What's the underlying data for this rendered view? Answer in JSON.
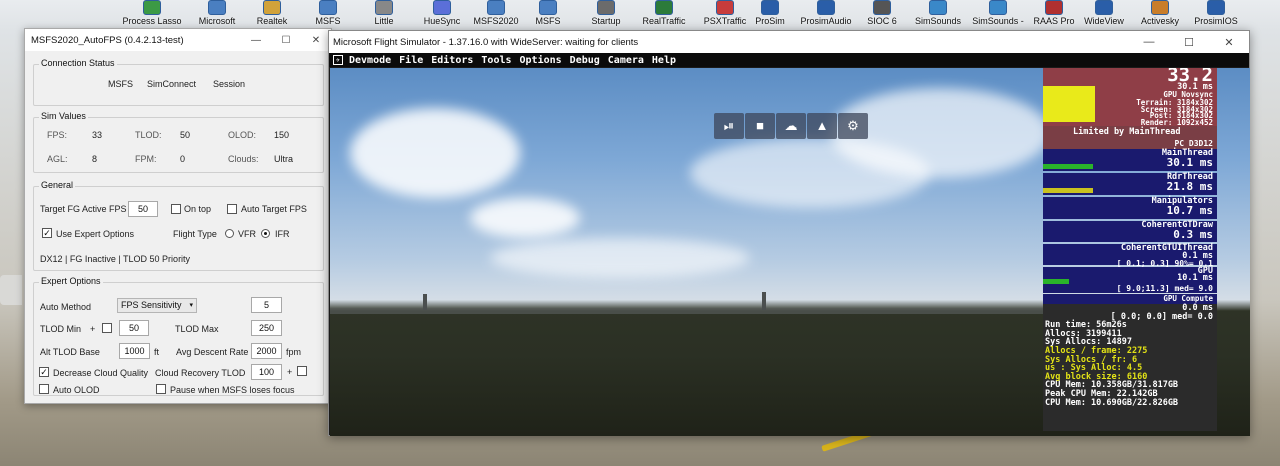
{
  "desktop": {
    "icons": [
      {
        "label": "Process Lasso",
        "x": "process"
      },
      {
        "label": "Microsoft",
        "x": "ms"
      },
      {
        "label": "Realtek",
        "x": "realtek"
      },
      {
        "label": "MSFS",
        "x": "msfs1"
      },
      {
        "label": "Little",
        "x": "little"
      },
      {
        "label": "HueSync",
        "x": "hue"
      },
      {
        "label": "MSFS2020",
        "x": "msfs2020"
      },
      {
        "label": "MSFS",
        "x": "msfs2"
      },
      {
        "label": "Startup",
        "x": "startup"
      },
      {
        "label": "RealTraffic",
        "x": "realtraffic"
      },
      {
        "label": "PSXTraffic",
        "x": "psx"
      },
      {
        "label": "ProSim",
        "x": "prosim"
      },
      {
        "label": "ProsimAudio",
        "x": "prosimaudio"
      },
      {
        "label": "SIOC 6",
        "x": "sioc"
      },
      {
        "label": "SimSounds",
        "x": "simsounds"
      },
      {
        "label": "SimSounds -",
        "x": "simsounds2"
      },
      {
        "label": "RAAS Pro",
        "x": "raas"
      },
      {
        "label": "WideView",
        "x": "wideview"
      },
      {
        "label": "Activesky",
        "x": "activesky"
      },
      {
        "label": "ProsimIOS",
        "x": "prosimios"
      }
    ]
  },
  "autofps": {
    "title": "MSFS2020_AutoFPS (0.4.2.13-test)",
    "min": "—",
    "max": "☐",
    "close": "✕",
    "connection": {
      "heading": "Connection Status",
      "items": [
        "MSFS",
        "SimConnect",
        "Session"
      ]
    },
    "sim_values": {
      "heading": "Sim Values",
      "fps_label": "FPS:",
      "fps": "33",
      "tlod_label": "TLOD:",
      "tlod": "50",
      "olod_label": "OLOD:",
      "olod": "150",
      "agl_label": "AGL:",
      "agl": "8",
      "fpm_label": "FPM:",
      "fpm": "0",
      "clouds_label": "Clouds:",
      "clouds": "Ultra"
    },
    "general": {
      "heading": "General",
      "target_label": "Target FG Active FPS",
      "target_value": "50",
      "on_top": "On top",
      "auto_target": "Auto Target FPS",
      "expert": "Use Expert Options",
      "flight_type": "Flight Type",
      "vfr": "VFR",
      "ifr": "IFR",
      "status": "DX12 | FG Inactive | TLOD 50 Priority"
    },
    "expert": {
      "heading": "Expert Options",
      "auto_method_label": "Auto Method",
      "auto_method_value": "FPS Sensitivity",
      "sensitivity": "5",
      "tlod_min_label": "TLOD Min",
      "plus": "+",
      "tlod_min": "50",
      "tlod_max_label": "TLOD Max",
      "tlod_max": "250",
      "alt_base_label": "Alt TLOD Base",
      "alt_base": "1000",
      "ft": "ft",
      "descent_label": "Avg Descent Rate",
      "descent": "2000",
      "fpm": "fpm",
      "decrease_cloud": "Decrease Cloud Quality",
      "cloud_recovery_label": "Cloud Recovery TLOD",
      "cloud_recovery": "100",
      "auto_olod": "Auto OLOD",
      "pause": "Pause when MSFS loses focus"
    }
  },
  "msfs": {
    "title": "Microsoft Flight Simulator - 1.37.16.0 with WideServer: waiting for clients",
    "min": "—",
    "max": "☐",
    "close": "✕",
    "menu": [
      "Devmode",
      "File",
      "Editors",
      "Tools",
      "Options",
      "Debug",
      "Camera",
      "Help"
    ],
    "toolbar_icons": [
      "play-pause-icon",
      "camera-icon",
      "weather-icon",
      "aircraft-icon",
      "settings-icon"
    ],
    "overlay": {
      "fps": "33.2",
      "lines_top": [
        "30.1 ms",
        "GPU Novsync",
        "Terrain: 3184x302",
        "Screen: 3184x302",
        "Post: 3184x302",
        "Render: 1092x452"
      ],
      "limited": "Limited by MainThread",
      "pc": "PC D3D12",
      "main_label": "MainThread",
      "main_ms": "30.1 ms",
      "rdr_label": "RdrThread",
      "rdr_ms": "21.8 ms",
      "manip_label": "Manipulators",
      "manip_ms": "10.7 ms",
      "coh_label": "CoherentGTDraw",
      "coh_ms": "0.3 ms",
      "coh2_label": "CoherentGTUIThread",
      "coh2_ms": "0.1 ms",
      "coh2_range": "[ 0.1; 0.3] 90%= 0.1",
      "gpu_label": "GPU",
      "gpu_ms": "10.1 ms",
      "gpu_range": "[ 9.0;11.3] med= 9.0",
      "gpuc_label": "GPU Compute",
      "gpuc_ms": "0.0 ms",
      "gpuc_range": "[ 0.0; 0.0] med= 0.0",
      "stats": [
        {
          "t": "Run time: 56m26s",
          "y": false
        },
        {
          "t": "Allocs: 3199411",
          "y": false
        },
        {
          "t": "  Sys Allocs: 14897",
          "y": false
        },
        {
          "t": "Allocs / frame: 2275",
          "y": true
        },
        {
          "t": "  Sys Allocs / fr: 6",
          "y": true
        },
        {
          "t": "  us : Sys Alloc: 4.5",
          "y": true
        },
        {
          "t": "Avg block size: 6160",
          "y": true
        },
        {
          "t": "CPU Mem: 10.358GB/31.817GB",
          "y": false
        },
        {
          "t": "Peak CPU Mem: 22.142GB",
          "y": false
        },
        {
          "t": "CPU Mem: 10.690GB/22.826GB",
          "y": false
        }
      ]
    }
  }
}
